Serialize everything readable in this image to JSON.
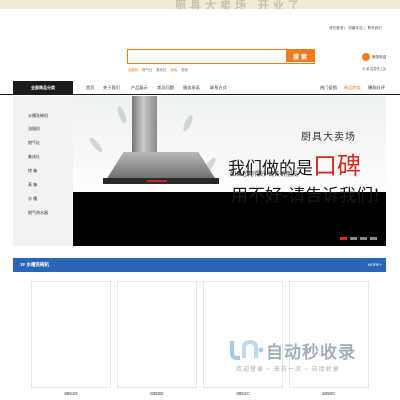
{
  "top_banner": {
    "text": "厨具大卖场 开业了"
  },
  "header": {
    "top_links": [
      "请先登录",
      "收藏本站",
      "联系我们"
    ],
    "search": {
      "placeholder": "",
      "button_label": "搜 索"
    },
    "hot_keywords": [
      "油烟机",
      "燃气灶",
      "集成灶",
      "消毒",
      "厨柜"
    ],
    "service": {
      "title": "服务电话",
      "subtitle": "安 聚 莫要来上莫"
    }
  },
  "nav": {
    "all_categories": "全部商品分类",
    "items": [
      "首页",
      "关于我们",
      "产品展示",
      "常见问题",
      "服务承诺",
      "联系方式"
    ],
    "right_items": [
      "热门促销",
      "新品特卖",
      "爆款好评"
    ]
  },
  "sidebar": {
    "categories": [
      "水槽洗碗机",
      "油烟机",
      "燃气灶",
      "集成灶",
      "烤 箱",
      "蒸 箱",
      "水 槽",
      "燃气热水器"
    ]
  },
  "hero": {
    "title": "厨具大卖场",
    "headline": "我们做的是",
    "headline_accent": "口碑",
    "subline": "如果您用得好-请告诉朋友",
    "bottom_line": "用不好-请告诉我们!"
  },
  "section": {
    "title": "1F 水槽洗碗机",
    "more": "MORE+",
    "products": [
      "8951D",
      "8350D",
      "8951C",
      "8350C"
    ]
  },
  "watermark": {
    "title": "自动秒收录",
    "subtitle": "欢迎登录 ~ 来访一次 ~ 自动收录"
  },
  "colors": {
    "accent": "#f07b1f",
    "nav_dark": "#1b1b1b",
    "section_blue": "#2a66b8",
    "hero_red": "#d42a20"
  }
}
